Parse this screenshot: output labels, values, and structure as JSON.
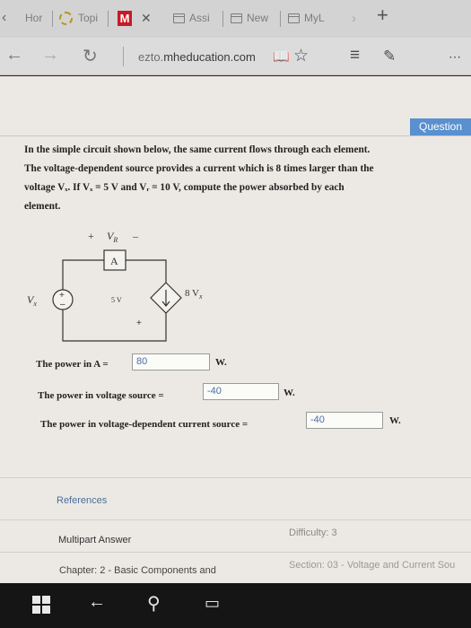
{
  "tabs": [
    {
      "label": "Hor"
    },
    {
      "label": "Topi"
    },
    {
      "label": "M"
    },
    {
      "label": "Assi"
    },
    {
      "label": "New"
    },
    {
      "label": "MyL"
    }
  ],
  "browser": {
    "url_host": "ezto.",
    "url_main": "mheducation.com"
  },
  "question_tab": "Question",
  "question": {
    "line1": "In the simple circuit shown below, the same current flows through each element.",
    "line2": "The voltage-dependent source provides a current which is 8 times larger than the",
    "line3": "voltage Vₓ. If Vₓ = 5 V  and  Vᵣ = 10 V,  compute the power absorbed by each",
    "line4": "element."
  },
  "circuit": {
    "plus": "+",
    "vr": "V",
    "vr_sub": "R",
    "minus": "–",
    "element_a": "A",
    "vx": "V",
    "vx_sub": "x",
    "source_value": "5 V",
    "dep_source": "8 V",
    "dep_sub": "x",
    "plus2": "+"
  },
  "answers": [
    {
      "label": "The power in  A =",
      "value": "80",
      "unit": "W."
    },
    {
      "label": "The power in voltage source =",
      "value": "-40",
      "unit": "W."
    },
    {
      "label": "The power in voltage-dependent current source =",
      "value": "-40",
      "unit": "W."
    }
  ],
  "footer": {
    "references": "References",
    "multipart": "Multipart Answer",
    "difficulty": "Difficulty: 3",
    "chapter": "Chapter: 2 - Basic Components and",
    "section": "Section: 03 - Voltage and Current Sou"
  }
}
